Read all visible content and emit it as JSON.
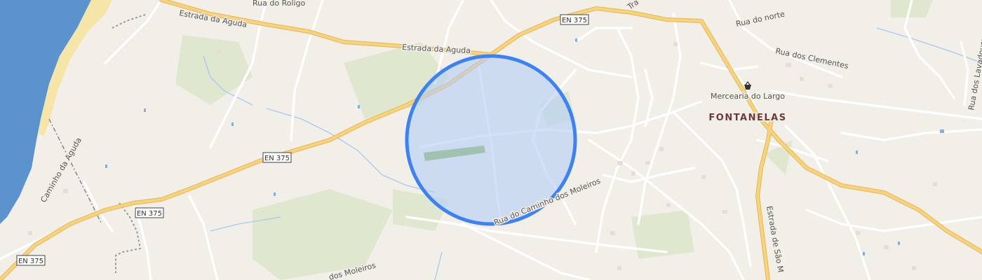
{
  "map": {
    "place_name": "FONTANELAS",
    "poi": {
      "name": "Mercearia do Largo",
      "icon": "shopping-basket-icon"
    },
    "route_shields": [
      {
        "id": "en375-top",
        "label": "EN 375"
      },
      {
        "id": "en375-mid",
        "label": "EN 375"
      },
      {
        "id": "en375-low",
        "label": "EN 375"
      },
      {
        "id": "en375-corner",
        "label": "EN 375"
      }
    ],
    "street_labels": {
      "rua_do_roligo": "Rua do Roligo",
      "estrada_da_aguda_1": "Estrada da Aguda",
      "estrada_da_aguda_2": "Estrada da Aguda",
      "caminho_da_aguda": "Caminho da Aguda",
      "rua_do_norte": "Rua do norte",
      "rua_dos_clementes": "Rua dos Clementes",
      "rua_dos_lavadouros": "Rua dos Lavadouros",
      "estrada_de_sao_m": "Estrada de São M",
      "rua_caminho_moleiros": "Rua do Caminho dos Moleiros",
      "dos_moleiros": "dos Moleiros",
      "tra": "Tra"
    },
    "colors": {
      "background": "#f2efe9",
      "water": "#5b93cf",
      "beach": "#f5e6a7",
      "park": "#dfe8cf",
      "major_road": "#f9d27a",
      "minor_road": "#ffffff",
      "radius_fill": "#b4cdf5",
      "radius_stroke": "#3b82f6",
      "town_label": "#6b3b3b"
    }
  }
}
